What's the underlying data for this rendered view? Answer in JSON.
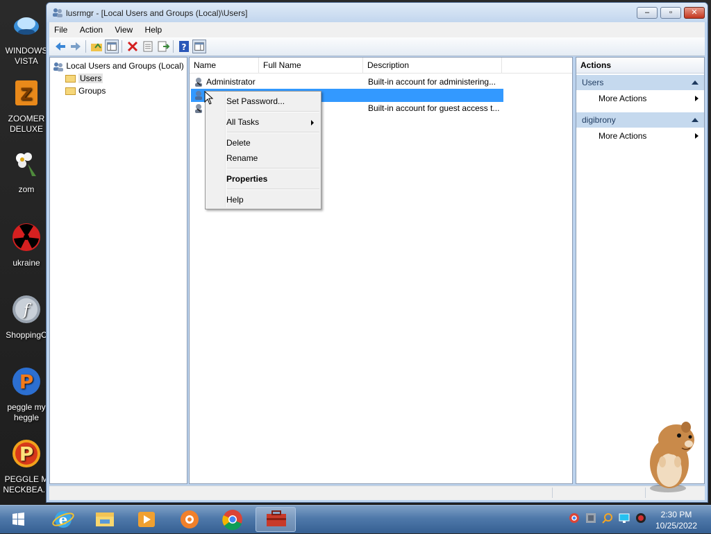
{
  "desktop_icons": [
    {
      "label_lines": [
        "WINDOWS",
        "VISTA"
      ],
      "icon": "windows-vista-orb-icon"
    },
    {
      "label_lines": [
        "ZOOMER",
        "DELUXE"
      ],
      "icon": "zoomer-deluxe-icon"
    },
    {
      "label_lines": [
        "zom"
      ],
      "icon": "flower-icon"
    },
    {
      "label_lines": [
        "ukraine"
      ],
      "icon": "radiation-icon"
    },
    {
      "label_lines": [
        "ShoppingC"
      ],
      "icon": "flash-icon"
    },
    {
      "label_lines": [
        "peggle my",
        "heggle"
      ],
      "icon": "peggle-icon"
    },
    {
      "label_lines": [
        "PEGGLE M",
        "NECKBEA..."
      ],
      "icon": "peggle-icon"
    }
  ],
  "window": {
    "title": "lusrmgr - [Local Users and Groups (Local)\\Users]",
    "menu": [
      "File",
      "Action",
      "View",
      "Help"
    ]
  },
  "tree": {
    "root": "Local Users and Groups (Local)",
    "children": [
      "Users",
      "Groups"
    ],
    "selected": "Users"
  },
  "list": {
    "columns": [
      "Name",
      "Full Name",
      "Description"
    ],
    "rows": [
      {
        "name": "Administrator",
        "full_name": "",
        "description": "Built-in account for administering..."
      },
      {
        "name": "",
        "full_name": "",
        "description": "",
        "selected": true
      },
      {
        "name": "",
        "full_name": "",
        "description": "Built-in account for guest access t..."
      }
    ]
  },
  "actions": {
    "title": "Actions",
    "sections": [
      {
        "header": "Users",
        "items": [
          "More Actions"
        ]
      },
      {
        "header": "digibrony",
        "items": [
          "More Actions"
        ]
      }
    ]
  },
  "context_menu": {
    "items": [
      "Set Password...",
      "All Tasks",
      "Delete",
      "Rename",
      "Properties",
      "Help"
    ],
    "default_item": "Properties"
  },
  "taskbar": {
    "time": "2:30 PM",
    "date": "10/25/2022"
  },
  "colors": {
    "selection": "#3399ff",
    "action_header": "#c5d9ee"
  }
}
